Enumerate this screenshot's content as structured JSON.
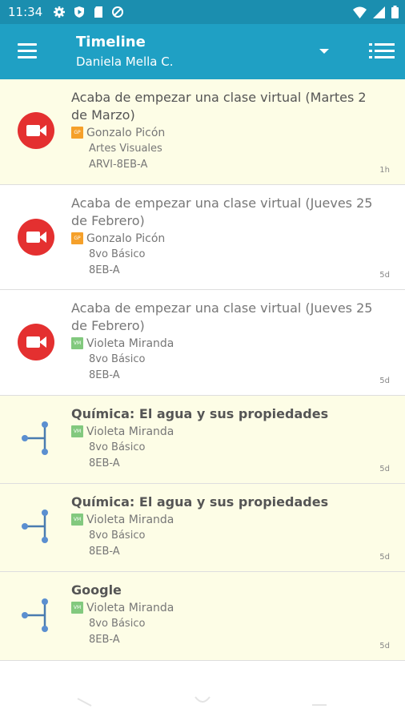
{
  "status_bar": {
    "time": "11:34"
  },
  "header": {
    "title": "Timeline",
    "subtitle": "Daniela Mella C."
  },
  "items": [
    {
      "type": "video",
      "highlight": true,
      "title": "Acaba de empezar una clase virtual (Martes 2 de Marzo)",
      "badge": "GP",
      "teacher": "Gonzalo Picón",
      "subject": "Artes Visuales",
      "course": "ARVI-8EB-A",
      "age": "1h"
    },
    {
      "type": "video",
      "highlight": false,
      "title": "Acaba de empezar una clase virtual (Jueves 25 de Febrero)",
      "badge": "GP",
      "teacher": "Gonzalo Picón",
      "subject": "8vo Básico",
      "course": "8EB-A",
      "age": "5d"
    },
    {
      "type": "video",
      "highlight": false,
      "title": "Acaba de empezar una clase virtual (Jueves 25 de Febrero)",
      "badge": "VM",
      "teacher": "Violeta Miranda",
      "subject": "8vo Básico",
      "course": "8EB-A",
      "age": "5d"
    },
    {
      "type": "content",
      "highlight": true,
      "title": "Química: El agua y sus propiedades",
      "badge": "VM",
      "teacher": "Violeta Miranda",
      "subject": "8vo Básico",
      "course": "8EB-A",
      "age": "5d"
    },
    {
      "type": "content",
      "highlight": true,
      "title": "Química: El agua y sus propiedades",
      "badge": "VM",
      "teacher": "Violeta Miranda",
      "subject": "8vo Básico",
      "course": "8EB-A",
      "age": "5d"
    },
    {
      "type": "content",
      "highlight": true,
      "title": "Google",
      "badge": "VM",
      "teacher": "Violeta Miranda",
      "subject": "8vo Básico",
      "course": "8EB-A",
      "age": "5d"
    }
  ]
}
